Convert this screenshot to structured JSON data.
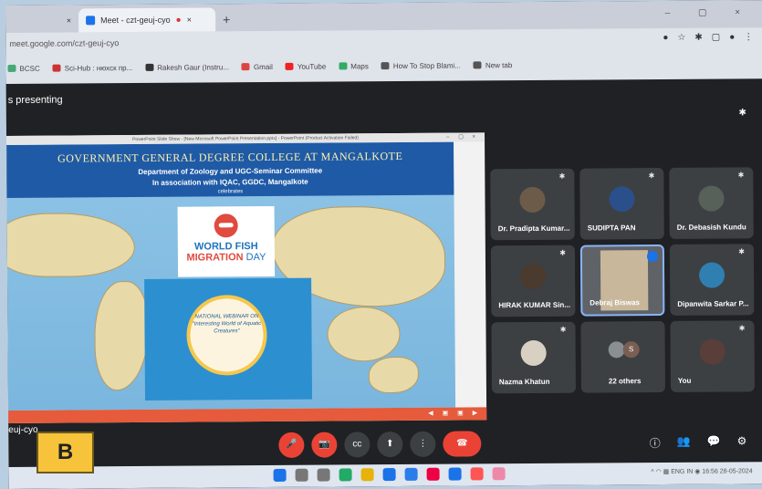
{
  "browser": {
    "tabs": [
      {
        "label": "",
        "close": "×"
      },
      {
        "label": "Meet - czt-geuj-cyo",
        "close": "×",
        "rec": "●"
      }
    ],
    "new_tab": "+",
    "window_controls": "–  ▢  ×",
    "url": "meet.google.com/czt-geuj-cyo",
    "addr_icons": [
      "●",
      "☆",
      "✱",
      "▢",
      "●",
      "⋮"
    ],
    "bookmarks": [
      {
        "label": "BCSC",
        "color": "#4a7"
      },
      {
        "label": "Sci-Hub : нюхск пр...",
        "color": "#c33"
      },
      {
        "label": "Rakesh Gaur (Instru...",
        "color": "#333"
      },
      {
        "label": "Gmail",
        "color": "#d44"
      },
      {
        "label": "YouTube",
        "color": "#e22"
      },
      {
        "label": "Maps",
        "color": "#3a6"
      },
      {
        "label": "How To Stop Blami...",
        "color": "#555"
      },
      {
        "label": "New tab",
        "color": "#555"
      }
    ]
  },
  "meet": {
    "presenting": "s presenting",
    "pin": "✱",
    "meeting_code": "euj-cyo",
    "controls": [
      "🎤",
      "📷",
      "cc",
      "⬆",
      "⋮",
      "☎"
    ],
    "right_controls": [
      "ⓘ",
      "👥",
      "💬",
      "⚙"
    ],
    "participants": [
      {
        "name": "Dr. Pradipta Kumar...",
        "pin": "✱"
      },
      {
        "name": "SUDIPTA PAN",
        "pin": "✱"
      },
      {
        "name": "Dr. Debasish Kundu",
        "pin": "✱"
      },
      {
        "name": "HIRAK KUMAR Sin...",
        "pin": "✱"
      },
      {
        "name": "Debraj Biswas",
        "pin": ""
      },
      {
        "name": "Dipanwita Sarkar P...",
        "pin": "✱"
      },
      {
        "name": "Nazma Khatun",
        "pin": "✱"
      },
      {
        "name": "22 others",
        "pin": ""
      },
      {
        "name": "You",
        "pin": "✱"
      }
    ],
    "others_initial": "S"
  },
  "slide": {
    "window_title": "PowerPoint Slide Show - [New Microsoft PowerPoint Presentation.pptx] - PowerPoint (Product Activation Failed)",
    "window_controls": "–  ▢  ×",
    "line1": "GOVERNMENT GENERAL DEGREE COLLEGE AT MANGALKOTE",
    "line2": "Department of Zoology and UGC-Seminar Committee",
    "line3": "In association with IQAC, GGDC, Mangalkote",
    "line4": "celebrates",
    "wfmd_line1": "WORLD FISH",
    "wfmd_line2": "MIGRATION",
    "wfmd_line2b": " DAY",
    "poster_text": "NATIONAL WEBINAR ON \"Interesting World of Aquatic Creatures\"",
    "bottom_controls": "◀ ▣ ▣ ▶"
  },
  "taskbar": {
    "icon_colors": [
      "#1a73e8",
      "#777",
      "#777",
      "#2a6",
      "#e8b20a",
      "#1a73e8",
      "#2b7de9",
      "#e04",
      "#1a73e8",
      "#f55",
      "#e8a"
    ],
    "tray": "^ ◠ ▦ ENG IN  ◉  16:56 28-05-2024"
  },
  "label": "B"
}
